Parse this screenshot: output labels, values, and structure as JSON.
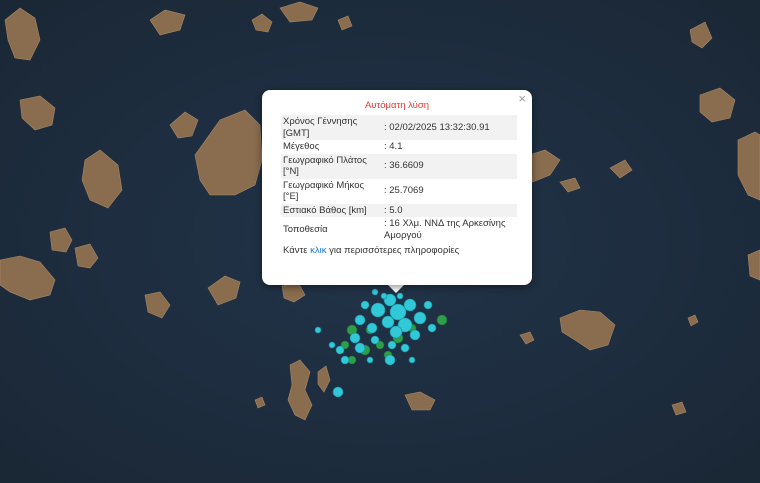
{
  "map": {
    "sea_color": "#1d2c3b",
    "land_color": "#8a6c4e",
    "marker_colors": {
      "recent": "#31c8d8",
      "older": "#2e9e4a"
    }
  },
  "popup": {
    "title": "Αυτόματη λύση",
    "close_icon": "×",
    "rows": [
      {
        "label": "Χρόνος Γέννησης [GMT]",
        "value": ": 02/02/2025 13:32:30.91"
      },
      {
        "label": "Μέγεθος",
        "value": ": 4.1"
      },
      {
        "label": "Γεωγραφικό Πλάτος [°N]",
        "value": ": 36.6609"
      },
      {
        "label": "Γεωγραφικό Μήκος [°E]",
        "value": ": 25.7069"
      },
      {
        "label": "Εστιακό Βάθος [km]",
        "value": ": 5.0"
      },
      {
        "label": "Τοποθεσία",
        "value": ": 16 Χλμ. ΝΝΔ της Αρκεσίνης Αμοργού"
      }
    ],
    "more_prefix": "Κάντε",
    "more_link": "κλικ",
    "more_suffix": "για περισσότερες πληροφορίες"
  }
}
